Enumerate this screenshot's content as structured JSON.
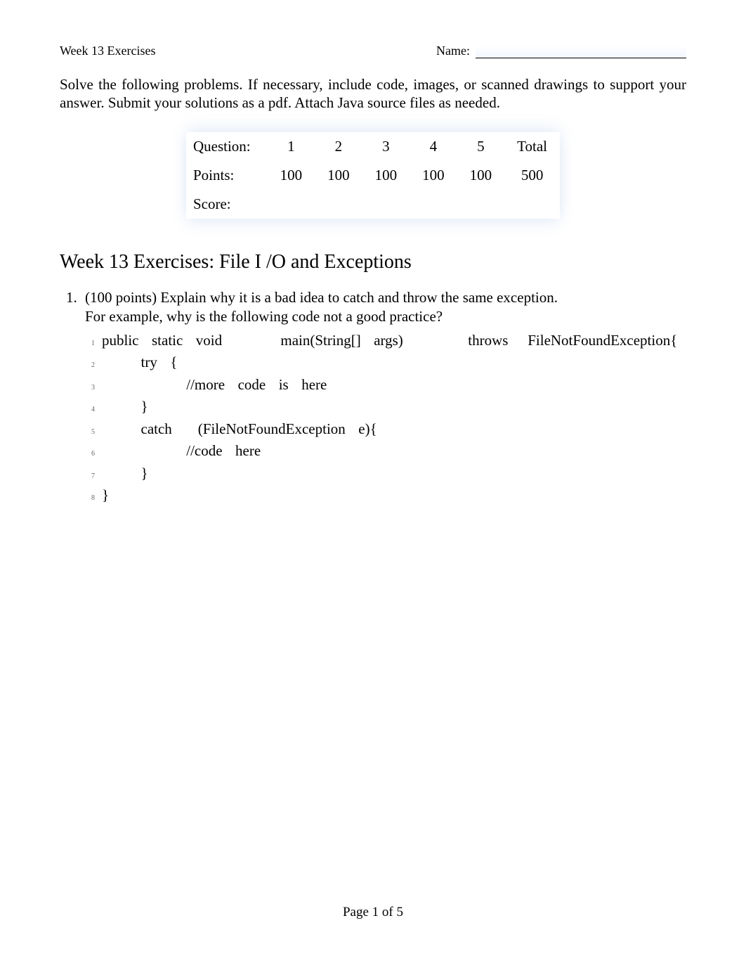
{
  "header": {
    "left": "Week 13 Exercises",
    "name_label": "Name:"
  },
  "intro": "Solve the following problems.      If necessary, include code, images, or scanned drawings to support your answer. Submit your solutions as a pdf. Attach Java source files as needed.",
  "score_table": {
    "row_labels": {
      "question": "Question:",
      "points": "Points:",
      "score": "Score:"
    },
    "columns": [
      "1",
      "2",
      "3",
      "4",
      "5",
      "Total"
    ],
    "points": [
      "100",
      "100",
      "100",
      "100",
      "100",
      "500"
    ]
  },
  "section_title": "Week 13 Exercises: File I   /O and Exceptions",
  "question1": {
    "prefix": "(100 points) ",
    "line1": "Explain why it is a bad idea to catch and throw the same exception.",
    "line2": "For example, why is the following code not a good practice?"
  },
  "code": [
    "public  static  void         main(String[]  args)          throws   FileNotFoundException{",
    "      try  {",
    "             //more  code  is  here",
    "      }",
    "      catch    (FileNotFoundException  e){",
    "             //code  here",
    "      }",
    "}"
  ],
  "footer": "Page 1 of 5"
}
